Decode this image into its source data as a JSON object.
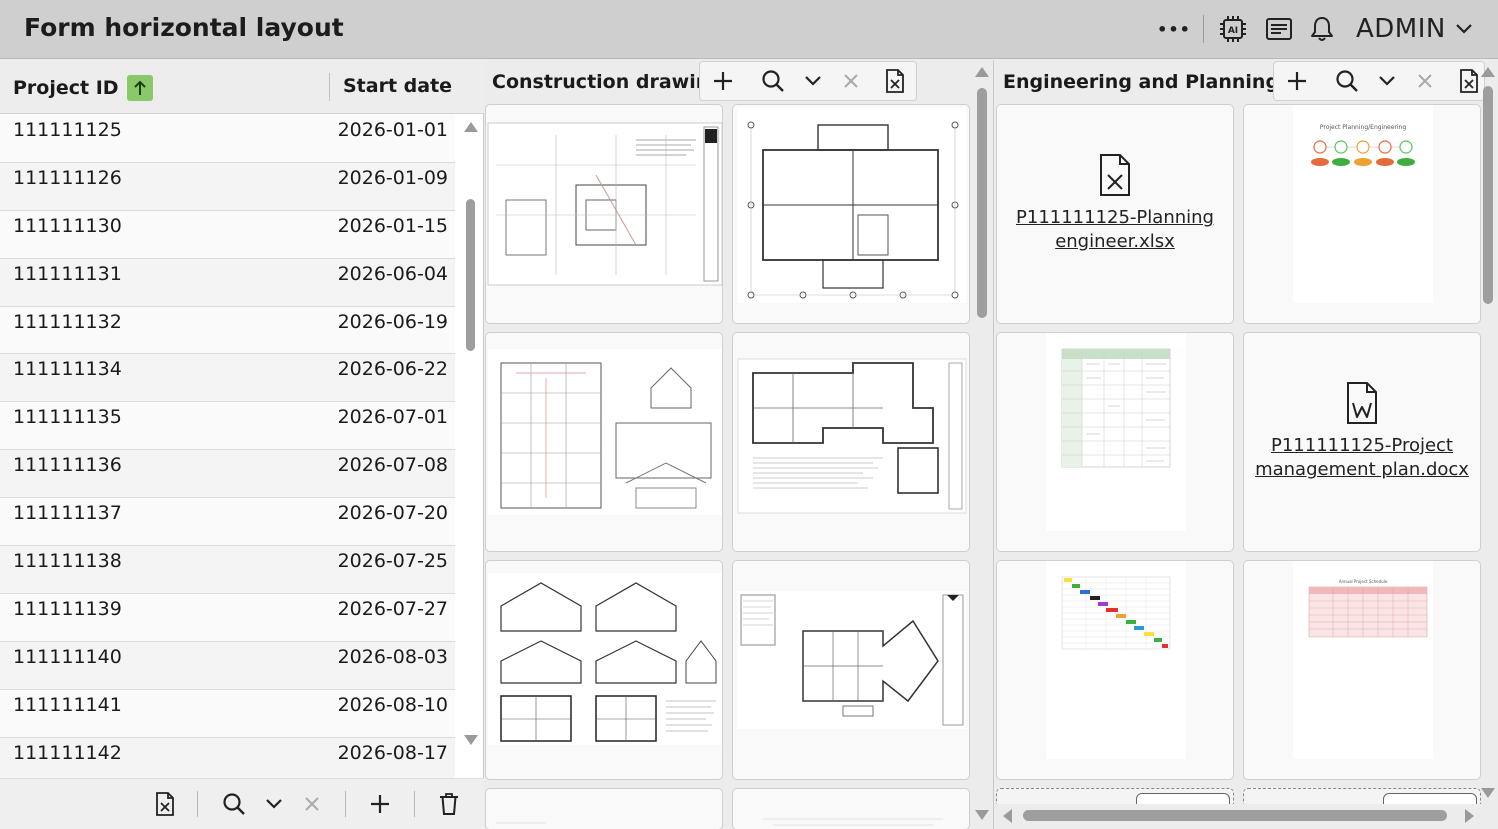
{
  "header": {
    "title": "Form horizontal layout",
    "more_label": "•••",
    "ai_label": "AI",
    "user_label": "ADMIN"
  },
  "table": {
    "col_project_id": "Project ID",
    "col_start_date": "Start date",
    "rows": [
      {
        "id": "111111125",
        "date": "2026-01-01"
      },
      {
        "id": "111111126",
        "date": "2026-01-09"
      },
      {
        "id": "111111130",
        "date": "2026-01-15"
      },
      {
        "id": "111111131",
        "date": "2026-06-04"
      },
      {
        "id": "111111132",
        "date": "2026-06-19"
      },
      {
        "id": "111111134",
        "date": "2026-06-22"
      },
      {
        "id": "111111135",
        "date": "2026-07-01"
      },
      {
        "id": "111111136",
        "date": "2026-07-08"
      },
      {
        "id": "111111137",
        "date": "2026-07-20"
      },
      {
        "id": "111111138",
        "date": "2026-07-25"
      },
      {
        "id": "111111139",
        "date": "2026-07-27"
      },
      {
        "id": "111111140",
        "date": "2026-08-03"
      },
      {
        "id": "111111141",
        "date": "2026-08-10"
      },
      {
        "id": "111111142",
        "date": "2026-08-17"
      }
    ]
  },
  "construction": {
    "title": "Construction drawings"
  },
  "engineering": {
    "title": "Engineering and Planning files",
    "files": [
      {
        "name": "P111111125-Planning engineer.xlsx",
        "line1": "P111111125-Planning",
        "line2": "engineer.xlsx",
        "icon": "excel-file-icon"
      },
      {
        "name": "P111111125-Project management plan.docx",
        "line1": "P111111125-Project",
        "line2": "management plan.docx",
        "icon": "word-file-icon"
      }
    ],
    "thumb_texts": {
      "roadmap_title": "Project Planning/Engineering",
      "schedule_title": "Annual Project Schedule"
    }
  },
  "colors": {
    "header_bg": "#cfcfcf",
    "sort_badge": "#8bc86a"
  }
}
